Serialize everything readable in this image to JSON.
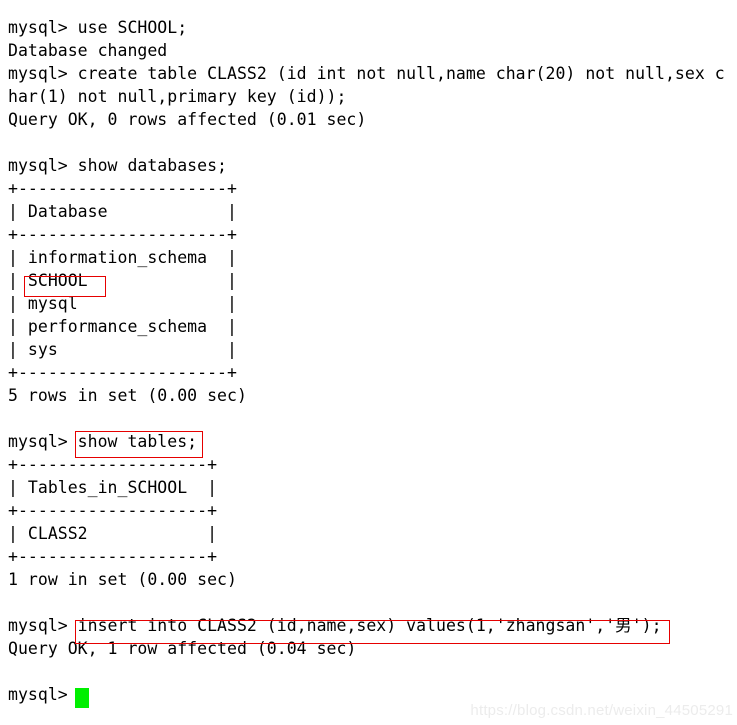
{
  "terminal": {
    "prompt": "mysql>",
    "cursor_color": "#00ef00",
    "highlight_color": "#e60000",
    "text_color": "#000000",
    "background_color": "#ffffff",
    "lines": [
      "mysql> use SCHOOL;",
      "Database changed",
      "mysql> create table CLASS2 (id int not null,name char(20) not null,sex c",
      "har(1) not null,primary key (id));",
      "Query OK, 0 rows affected (0.01 sec)",
      "",
      "mysql> show databases;",
      "+---------------------+",
      "| Database            |",
      "+---------------------+",
      "| information_schema  |",
      "| SCHOOL              |",
      "| mysql               |",
      "| performance_schema  |",
      "| sys                 |",
      "+---------------------+",
      "5 rows in set (0.00 sec)",
      "",
      "mysql> show tables;",
      "+-------------------+",
      "| Tables_in_SCHOOL  |",
      "+-------------------+",
      "| CLASS2            |",
      "+-------------------+",
      "1 row in set (0.00 sec)",
      "",
      "mysql> insert into CLASS2 (id,name,sex) values(1,'zhangsan','男');",
      "Query OK, 1 row affected (0.04 sec)",
      "",
      "mysql> "
    ]
  },
  "annotations": {
    "school_label": "SCHOOL",
    "show_tables_label": "show tables;",
    "insert_label": "insert into CLASS2 (id,name,sex) values(1,'zhangsan','男');"
  },
  "watermark": {
    "text": "https://blog.csdn.net/weixin_44505291"
  }
}
